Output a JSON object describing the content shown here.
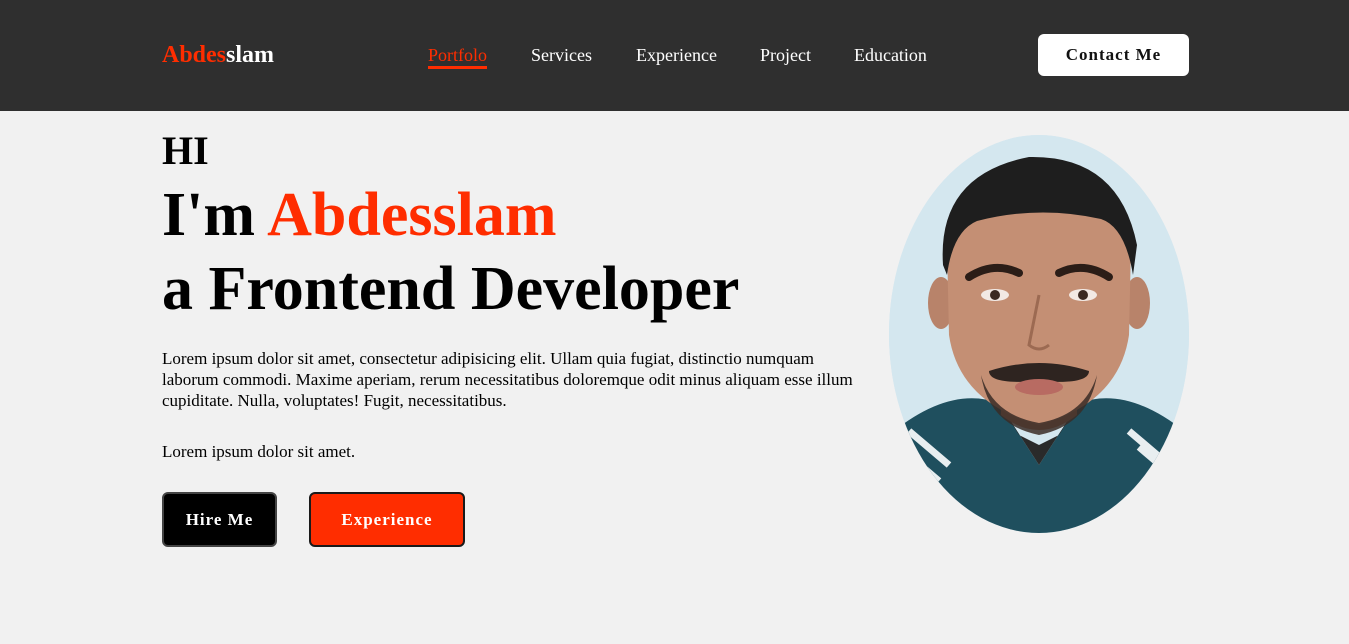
{
  "header": {
    "logo_accent": "Abdes",
    "logo_rest": "slam",
    "nav": [
      {
        "label": "Portfolo"
      },
      {
        "label": "Services"
      },
      {
        "label": "Experience"
      },
      {
        "label": "Project"
      },
      {
        "label": "Education"
      }
    ],
    "contact_label": "Contact Me"
  },
  "hero": {
    "greeting": "HI",
    "intro_prefix": "I'm ",
    "name": "Abdesslam",
    "role": "a Frontend Developer",
    "description": "Lorem ipsum dolor sit amet, consectetur adipisicing elit. Ullam quia fugiat, distinctio numquam laborum commodi. Maxime aperiam, rerum necessitatibus doloremque odit minus aliquam esse illum cupiditate. Nulla, voluptates! Fugit, necessitatibus.",
    "tagline": "Lorem ipsum dolor sit amet.",
    "hire_label": "Hire Me",
    "experience_label": "Experience"
  },
  "colors": {
    "accent": "#ff2d00",
    "header_bg": "#2f2f2f",
    "page_bg": "#f1f1f1"
  }
}
